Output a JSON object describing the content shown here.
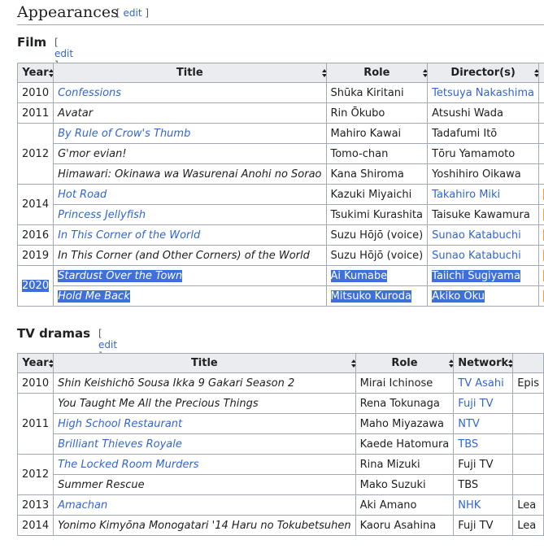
{
  "section": {
    "title": "Appearances",
    "edit": "edit"
  },
  "film": {
    "title": "Film",
    "edit": "edit",
    "headers": [
      "Year",
      "Title",
      "Role",
      "Director(s)"
    ],
    "rows": [
      {
        "year": "2010",
        "title": "Confessions",
        "title_link": true,
        "role": "Shūka Kiritani",
        "role_link": false,
        "director": "Tetsuya Nakashima",
        "director_link": true
      },
      {
        "year": "2011",
        "title": "Avatar",
        "title_link": false,
        "role": "Rin Ōkubo",
        "role_link": false,
        "director": "Atsushi Wada",
        "director_link": false
      },
      {
        "year": "2012",
        "title": "By Rule of Crow's Thumb",
        "title_link": true,
        "role": "Mahiro Kawai",
        "role_link": false,
        "director": "Tadafumi Itō",
        "director_link": false
      },
      {
        "year": "",
        "title": "G'mor evian!",
        "title_link": false,
        "role": "Tomo-chan",
        "role_link": false,
        "director": "Tōru Yamamoto",
        "director_link": false
      },
      {
        "year": "",
        "title": "Himawari: Okinawa wa Wasurenai Anohi no Sorao",
        "title_link": false,
        "role": "Kana Shiroma",
        "role_link": false,
        "director": "Yoshihiro Oikawa",
        "director_link": false
      },
      {
        "year": "2014",
        "title": "Hot Road",
        "title_link": true,
        "role": "Kazuki Miyaichi",
        "role_link": false,
        "director": "Takahiro Miki",
        "director_link": true
      },
      {
        "year": "",
        "title": "Princess Jellyfish",
        "title_link": true,
        "role": "Tsukimi Kurashita",
        "role_link": false,
        "director": "Taisuke Kawamura",
        "director_link": false
      },
      {
        "year": "2016",
        "title": "In This Corner of the World",
        "title_link": true,
        "role": "Suzu Hōjō (voice)",
        "role_link": false,
        "director": "Sunao Katabuchi",
        "director_link": true
      },
      {
        "year": "2019",
        "title": "In This Corner (and Other Corners) of the World",
        "title_link": false,
        "role": "Suzu Hōjō (voice)",
        "role_link": false,
        "director": "Sunao Katabuchi",
        "director_link": true
      },
      {
        "year": "2020",
        "title": "Stardust Over the Town",
        "title_link": true,
        "role": "Ai Kumabe",
        "role_link": true,
        "director": "Taiichi Sugiyama",
        "director_link": true
      },
      {
        "year": "",
        "title": "Hold Me Back",
        "title_link": true,
        "role": "Mitsuko Kuroda",
        "role_link": true,
        "director": "Akiko Ōku",
        "director_link": true
      }
    ]
  },
  "tv": {
    "title": "TV dramas",
    "edit": "edit",
    "headers": [
      "Year",
      "Title",
      "Role",
      "Network"
    ],
    "rows": [
      {
        "year": "2010",
        "title": "Shin Keishichō Sousa Ikka 9 Gakari Season 2",
        "title_link": false,
        "role": "Mirai Ichinose",
        "network": "TV Asahi",
        "network_link": true,
        "note": "Epis"
      },
      {
        "year": "2011",
        "title": "You Taught Me All the Precious Things",
        "title_link": false,
        "role": "Rena Tokunaga",
        "network": "Fuji TV",
        "network_link": true,
        "note": ""
      },
      {
        "year": "",
        "title": "High School Restaurant",
        "title_link": true,
        "role": "Maho Miyazawa",
        "network": "NTV",
        "network_link": true,
        "note": ""
      },
      {
        "year": "",
        "title": "Brilliant Thieves Royale",
        "title_link": true,
        "role": "Kaede Hatomura",
        "network": "TBS",
        "network_link": true,
        "note": ""
      },
      {
        "year": "2012",
        "title": "The Locked Room Murders",
        "title_link": true,
        "role": "Rina Mizuki",
        "network": "Fuji TV",
        "network_link": false,
        "note": ""
      },
      {
        "year": "",
        "title": "Summer Rescue",
        "title_link": false,
        "role": "Mako Suzuki",
        "network": "TBS",
        "network_link": false,
        "note": ""
      },
      {
        "year": "2013",
        "title": "Amachan",
        "title_link": true,
        "role": "Aki Amano",
        "network": "NHK",
        "network_link": true,
        "note": "Lea"
      },
      {
        "year": "2014",
        "title": "Yonimo Kimyōna Monogatari '14 Haru no Tokubetsuhen",
        "title_link": false,
        "role": "Kaoru Asahina",
        "network": "Fuji TV",
        "network_link": false,
        "note": "Lea"
      }
    ]
  }
}
